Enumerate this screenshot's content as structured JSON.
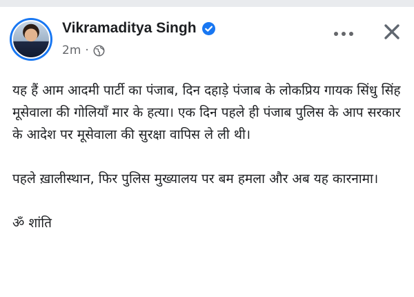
{
  "post": {
    "author_name": "Vikramaditya Singh",
    "timestamp": "2m",
    "separator": "·",
    "privacy_icon": "globe-icon",
    "verified_icon": "verified-badge-icon",
    "more_icon": "more-horizontal-icon",
    "close_icon": "close-icon",
    "paragraphs": [
      "यह हैं आम आदमी पार्टी का पंजाब, दिन दहाड़े पंजाब के लोकप्रिय गायक सिंधु सिंह मूसेवाला की गोलियाँ मार के हत्या। एक दिन पहले ही पंजाब पुलिस के आप सरकार के आदेश पर मूसेवाला की सुरक्षा वापिस ले ली थी।",
      "पहले ख़ालीस्थान, फिर पुलिस मुख्यालय पर बम हमला और अब यह कारनामा।",
      "ॐ शांति"
    ]
  },
  "colors": {
    "accent": "#1877f2",
    "text": "#1c1e21",
    "meta": "#65676b",
    "background": "#ffffff",
    "topbar": "#e9ebee"
  }
}
